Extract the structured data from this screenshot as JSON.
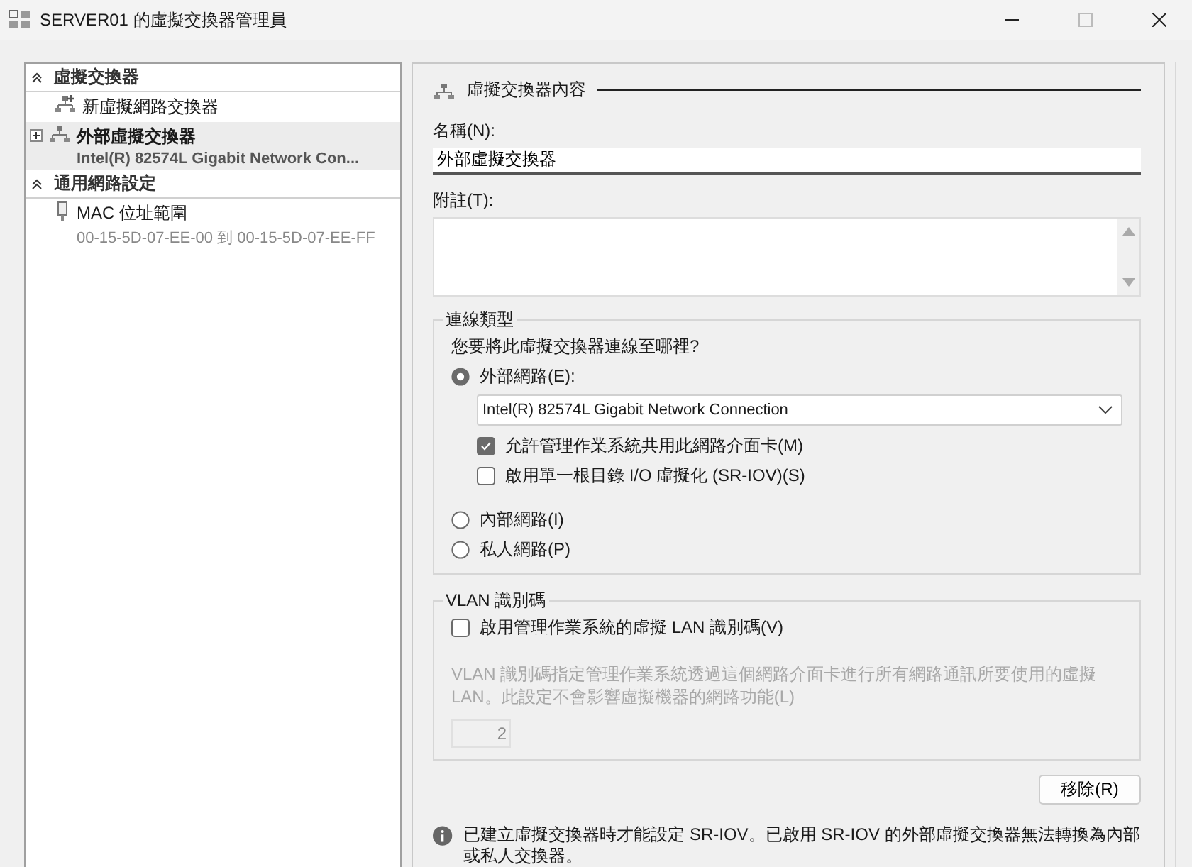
{
  "window": {
    "title": "SERVER01 的虛擬交換器管理員"
  },
  "sidebar": {
    "sections": [
      {
        "title": "虛擬交換器",
        "expanded": true,
        "items": [
          {
            "kind": "new",
            "label": "新虛擬網路交換器",
            "selected": false
          },
          {
            "kind": "switch",
            "label": "外部虛擬交換器",
            "detail": "Intel(R) 82574L Gigabit Network Con...",
            "selected": true,
            "expanded": false
          }
        ]
      },
      {
        "title": "通用網路設定",
        "expanded": true,
        "items": [
          {
            "kind": "mac",
            "label": "MAC 位址範圍",
            "detail": "00-15-5D-07-EE-00 到 00-15-5D-07-EE-FF",
            "selected": false
          }
        ]
      }
    ]
  },
  "properties": {
    "title": "虛擬交換器內容",
    "name_label": "名稱(N):",
    "name_value": "外部虛擬交換器",
    "notes_label": "附註(T):",
    "connection": {
      "legend": "連線類型",
      "question": "您要將此虛擬交換器連線至哪裡?",
      "options": [
        {
          "kind": "adapter",
          "label": "外部網路(E):",
          "selected": true,
          "adapter": "Intel(R) 82574L Gigabit Network Connection",
          "checkboxes": [
            {
              "label": "允許管理作業系統共用此網路介面卡(M)",
              "checked": true
            },
            {
              "label": "啟用單一根目錄 I/O 虛擬化 (SR-IOV)(S)",
              "checked": false
            }
          ]
        },
        {
          "kind": "plain",
          "label": "內部網路(I)",
          "selected": false
        },
        {
          "kind": "plain",
          "label": "私人網路(P)",
          "selected": false
        }
      ]
    },
    "vlan": {
      "legend": "VLAN 識別碼",
      "checkbox": {
        "label": "啟用管理作業系統的虛擬 LAN 識別碼(V)",
        "checked": false
      },
      "description": "VLAN 識別碼指定管理作業系統透過這個網路介面卡進行所有網路通訊所要使用的虛擬 LAN。此設定不會影響虛擬機器的網路功能(L)",
      "disabled": true,
      "id_value": "2"
    },
    "remove_button": "移除(R)",
    "note": "已建立虛擬交換器時才能設定 SR-IOV。已啟用 SR-IOV 的外部虛擬交換器無法轉換為內部或私人交換器。"
  }
}
